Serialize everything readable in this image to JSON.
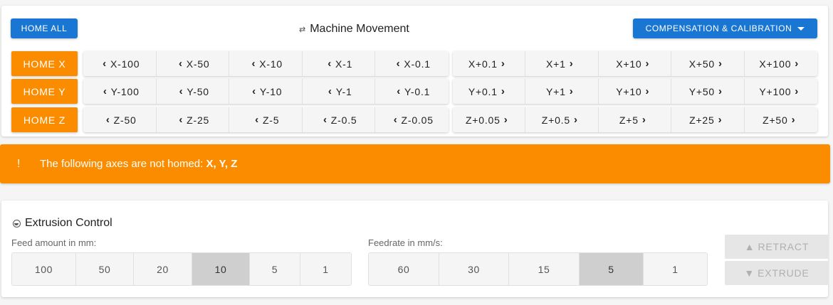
{
  "movement": {
    "home_all": "HOME ALL",
    "title": "Machine Movement",
    "compensation": "COMPENSATION & CALIBRATION",
    "rows": [
      {
        "home": "HOME X",
        "neg": [
          "X-100",
          "X-50",
          "X-10",
          "X-1",
          "X-0.1"
        ],
        "pos": [
          "X+0.1",
          "X+1",
          "X+10",
          "X+50",
          "X+100"
        ]
      },
      {
        "home": "HOME Y",
        "neg": [
          "Y-100",
          "Y-50",
          "Y-10",
          "Y-1",
          "Y-0.1"
        ],
        "pos": [
          "Y+0.1",
          "Y+1",
          "Y+10",
          "Y+50",
          "Y+100"
        ]
      },
      {
        "home": "HOME Z",
        "neg": [
          "Z-50",
          "Z-25",
          "Z-5",
          "Z-0.5",
          "Z-0.05"
        ],
        "pos": [
          "Z+0.05",
          "Z+0.5",
          "Z+5",
          "Z+25",
          "Z+50"
        ]
      }
    ]
  },
  "alert": {
    "icon": "!",
    "text": "The following axes are not homed: ",
    "axes": "X, Y, Z"
  },
  "extrusion": {
    "title": "Extrusion Control",
    "feed_label": "Feed amount in mm:",
    "feed_options": [
      "100",
      "50",
      "20",
      "10",
      "5",
      "1"
    ],
    "feed_selected": "10",
    "rate_label": "Feedrate in mm/s:",
    "rate_options": [
      "60",
      "30",
      "15",
      "5",
      "1"
    ],
    "rate_selected": "5",
    "retract": "RETRACT",
    "extrude": "EXTRUDE"
  },
  "colors": {
    "primary": "#1976d2",
    "warning": "#fb8c00"
  }
}
